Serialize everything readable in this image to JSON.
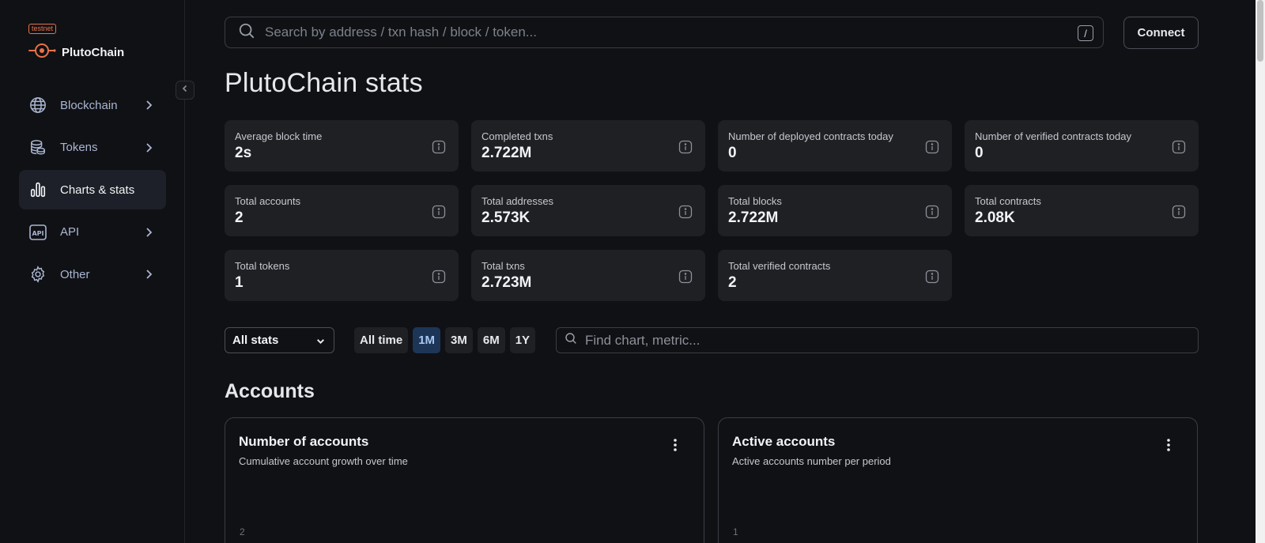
{
  "brand": {
    "badge": "testnet",
    "name": "PlutoChain"
  },
  "sidebar": {
    "items": [
      {
        "label": "Blockchain",
        "icon": "globe-icon",
        "has_chevron": true,
        "active": false
      },
      {
        "label": "Tokens",
        "icon": "coins-icon",
        "has_chevron": true,
        "active": false
      },
      {
        "label": "Charts & stats",
        "icon": "bar-chart-icon",
        "has_chevron": false,
        "active": true
      },
      {
        "label": "API",
        "icon": "api-icon",
        "has_chevron": true,
        "active": false
      },
      {
        "label": "Other",
        "icon": "gear-icon",
        "has_chevron": true,
        "active": false
      }
    ]
  },
  "header": {
    "search_placeholder": "Search by address / txn hash / block / token...",
    "shortcut_key": "/",
    "connect_label": "Connect"
  },
  "page_title": "PlutoChain stats",
  "stats": [
    {
      "label": "Average block time",
      "value": "2s"
    },
    {
      "label": "Completed txns",
      "value": "2.722M"
    },
    {
      "label": "Number of deployed contracts today",
      "value": "0"
    },
    {
      "label": "Number of verified contracts today",
      "value": "0"
    },
    {
      "label": "Total accounts",
      "value": "2"
    },
    {
      "label": "Total addresses",
      "value": "2.573K"
    },
    {
      "label": "Total blocks",
      "value": "2.722M"
    },
    {
      "label": "Total contracts",
      "value": "2.08K"
    },
    {
      "label": "Total tokens",
      "value": "1"
    },
    {
      "label": "Total txns",
      "value": "2.723M"
    },
    {
      "label": "Total verified contracts",
      "value": "2"
    }
  ],
  "filters": {
    "select_value": "All stats",
    "periods": [
      "All time",
      "1M",
      "3M",
      "6M",
      "1Y"
    ],
    "active_period": "1M",
    "find_placeholder": "Find chart, metric..."
  },
  "section_title": "Accounts",
  "charts": [
    {
      "title": "Number of accounts",
      "subtitle": "Cumulative account growth over time",
      "axis_tick": "2"
    },
    {
      "title": "Active accounts",
      "subtitle": "Active accounts number per period",
      "axis_tick": "1"
    }
  ],
  "colors": {
    "accent": "#e8724a",
    "active_period_bg": "#1d3557",
    "card_bg": "#1f2024",
    "page_bg": "#101114"
  }
}
